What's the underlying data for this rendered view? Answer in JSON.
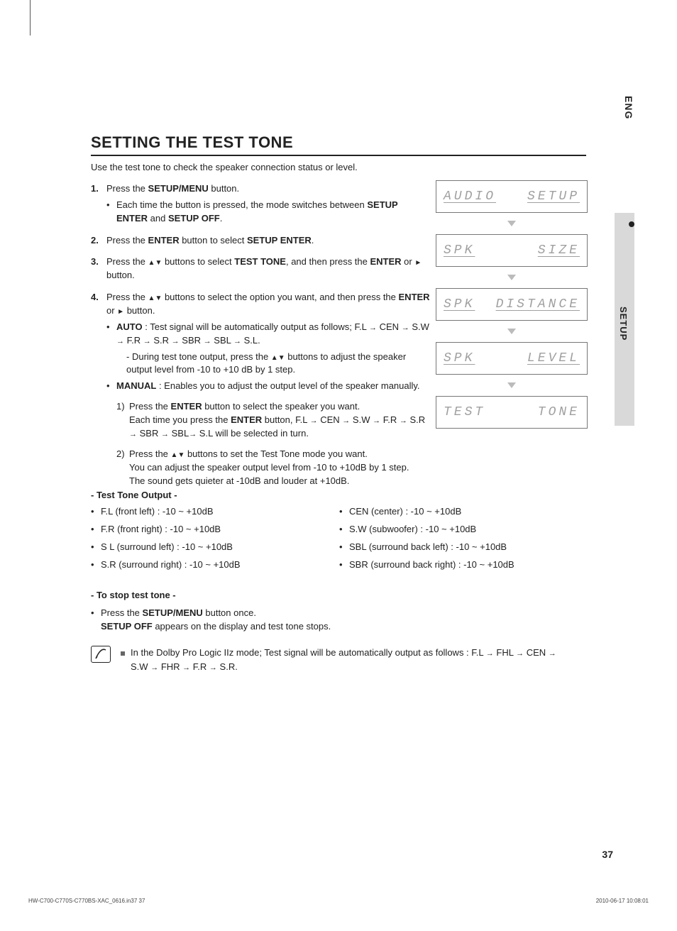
{
  "lang_tab": "ENG",
  "section_tab": "SETUP",
  "title": "SETTING THE TEST TONE",
  "intro": "Use the test tone to check the speaker connection status or level.",
  "steps": {
    "s1": {
      "lead": "Press the ",
      "btn": "SETUP/MENU",
      "tail": " button.",
      "bul_lead": "Each time the button is pressed, the mode switches between ",
      "b1": "SETUP ENTER",
      "mid": " and ",
      "b2": "SETUP OFF",
      "end": "."
    },
    "s2": {
      "lead": "Press the ",
      "btn": "ENTER",
      "mid": " button to select ",
      "b2": "SETUP ENTER",
      "end": "."
    },
    "s3": {
      "lead": "Press the ",
      "mid": " buttons to select ",
      "b1": "TEST TONE",
      "mid2": ", and then press the ",
      "btn": "ENTER",
      "mid3": " or ",
      "end": " button."
    },
    "s4": {
      "lead": "Press the ",
      "mid": " buttons to select the option you want, and then press the ",
      "btn": "ENTER",
      "mid2": " or ",
      "end": " button.",
      "auto": {
        "label": "AUTO",
        "text": " : Test signal will be automatically output as follows;  F.L ",
        "seq": [
          "CEN",
          "S.W",
          "F.R",
          "S.R",
          "SBR",
          "SBL",
          "S.L."
        ],
        "dash": "During test tone output, press the ",
        "dash_tail": " buttons to adjust the speaker output level from -10 to +10 dB by 1 step."
      },
      "manual": {
        "label": "MANUAL",
        "text": " : Enables you to adjust the output level of the speaker manually.",
        "n1_a": "Press the ",
        "n1_btn": "ENTER",
        "n1_b": " button to select the speaker you want.",
        "n1_c": "Each time you press the ",
        "n1_btn2": "ENTER",
        "n1_d": " button, F.L ",
        "seq": [
          "CEN",
          "S.W",
          "F.R",
          "S.R",
          "SBR",
          "SBL"
        ],
        "n1_e": " S.L will be selected in turn.",
        "n2_a": "Press the ",
        "n2_b": " buttons to set the Test Tone mode you want.",
        "n2_c": "You can adjust the speaker output level from -10 to +10dB by 1 step.",
        "n2_d": "The sound gets quieter at -10dB and louder at +10dB."
      }
    }
  },
  "displays": [
    {
      "left": "AUDIO",
      "right": "SETUP",
      "underline": true
    },
    {
      "left": "SPK",
      "right": "SIZE",
      "underline": true
    },
    {
      "left": "SPK",
      "right": "DISTANCE",
      "underline": true
    },
    {
      "left": "SPK",
      "right": "LEVEL",
      "underline": true
    },
    {
      "left": "TEST",
      "right": "TONE",
      "underline": false
    }
  ],
  "tt_header": "- Test Tone Output -",
  "tt_left": [
    "F.L (front left) : -10 ~ +10dB",
    "F.R (front right) : -10 ~ +10dB",
    "S L (surround left) : -10 ~ +10dB",
    "S.R (surround right) : -10 ~ +10dB"
  ],
  "tt_right": [
    "CEN (center) : -10 ~ +10dB",
    "S.W (subwoofer) : -10 ~ +10dB",
    "SBL (surround back left) : -10 ~ +10dB",
    "SBR (surround back right) : -10 ~ +10dB"
  ],
  "stop_header": "- To stop test tone -",
  "stop_lead": "Press the ",
  "stop_btn": "SETUP/MENU",
  "stop_tail": " button once.",
  "stop_line2a": "SETUP OFF",
  "stop_line2b": " appears on the display and test tone stops.",
  "note_a": "In the Dolby Pro Logic IIz mode; Test signal will be automatically output as follows :  F.L ",
  "note_seq": [
    "FHL",
    "CEN",
    "S.W",
    "FHR",
    "F.R",
    "S.R."
  ],
  "page_number": "37",
  "footer_left": "HW-C700-C770S-C770BS-XAC_0616.in37   37",
  "footer_right": "2010-06-17   10:08:01"
}
